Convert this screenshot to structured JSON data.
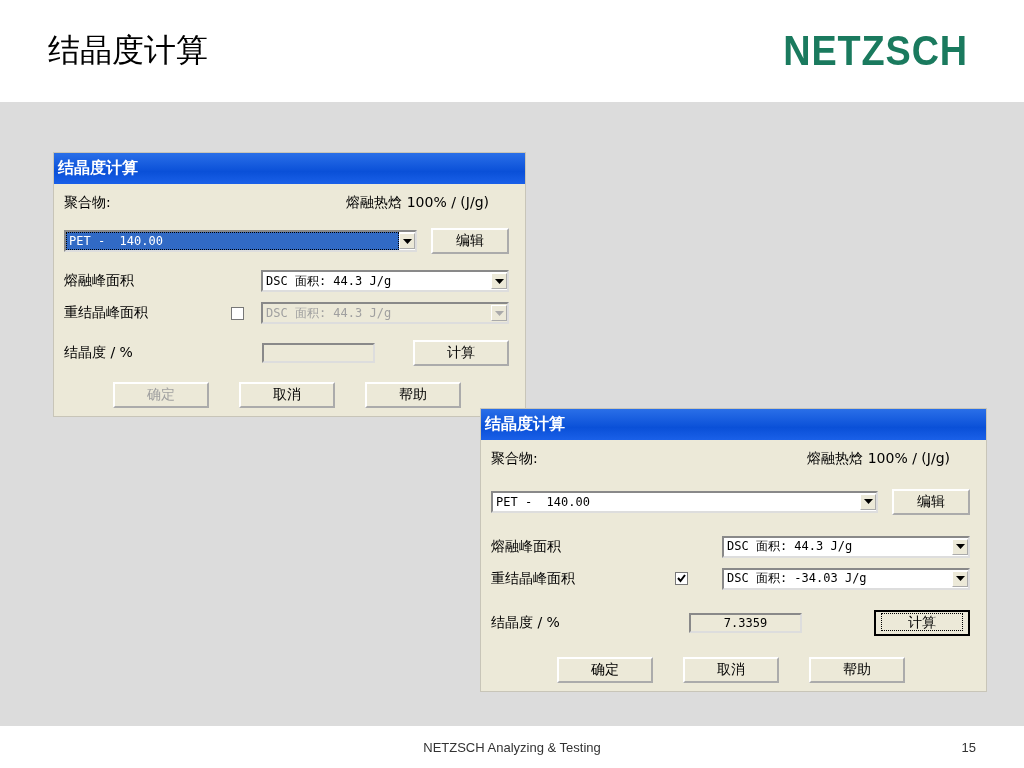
{
  "slide": {
    "title": "结晶度计算",
    "logo": "NETZSCH",
    "footer": "NETZSCH Analyzing & Testing",
    "page_number": "15"
  },
  "dialogs": [
    {
      "title": "结晶度计算",
      "polymer_label": "聚合物:",
      "enthalpy_label": "熔融热焓 100% / (J/g)",
      "polymer_select": {
        "value": "PET -  140.00",
        "selected": true
      },
      "edit_button": "编辑",
      "melt_label": "熔融峰面积",
      "melt_select": {
        "value": "DSC 面积: 44.3 J/g",
        "disabled": false
      },
      "recryst_label": "重结晶峰面积",
      "recryst_checkbox": {
        "checked": false
      },
      "recryst_select": {
        "value": "DSC 面积: 44.3 J/g",
        "disabled": true
      },
      "crystallinity_label": "结晶度 / %",
      "calc_button": {
        "label": "计算",
        "focused": false
      },
      "buttons": [
        {
          "label": "确定",
          "disabled": true
        },
        {
          "label": "取消",
          "disabled": false
        },
        {
          "label": "帮助",
          "disabled": false
        }
      ]
    },
    {
      "title": "结晶度计算",
      "polymer_label": "聚合物:",
      "enthalpy_label": "熔融热焓 100% / (J/g)",
      "polymer_select": {
        "value": "PET -  140.00",
        "selected": false
      },
      "edit_button": "编辑",
      "melt_label": "熔融峰面积",
      "melt_select": {
        "value": "DSC 面积: 44.3 J/g",
        "disabled": false
      },
      "recryst_label": "重结晶峰面积",
      "recryst_checkbox": {
        "checked": true
      },
      "recryst_select": {
        "value": "DSC 面积: -34.03 J/g",
        "disabled": false
      },
      "crystallinity_label": "结晶度 / %",
      "crystallinity_value": "7.3359",
      "calc_button": {
        "label": "计算",
        "focused": true
      },
      "buttons": [
        {
          "label": "确定",
          "disabled": false
        },
        {
          "label": "取消",
          "disabled": false
        },
        {
          "label": "帮助",
          "disabled": false
        }
      ]
    }
  ]
}
